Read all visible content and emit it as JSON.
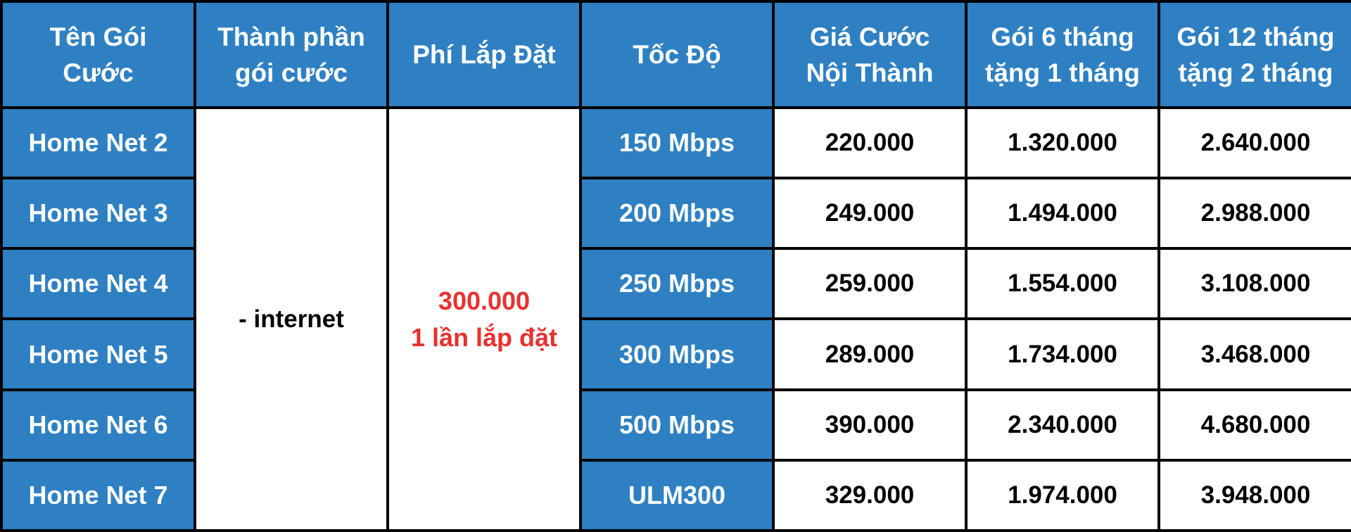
{
  "colors": {
    "header_bg": "#2e80c2",
    "header_text": "#ffffff",
    "cell_bg": "#ffffff",
    "grid_lines": "#000000",
    "install_fee_text": "#e8312f"
  },
  "headers": [
    {
      "line1": "Tên Gói",
      "line2": "Cước"
    },
    {
      "line1": "Thành phần",
      "line2": "gói cước"
    },
    {
      "line1": "Phí Lắp Đặt",
      "line2": ""
    },
    {
      "line1": "Tốc Độ",
      "line2": ""
    },
    {
      "line1": "Giá Cước",
      "line2": "Nội Thành"
    },
    {
      "line1": "Gói 6 tháng",
      "line2": "tặng 1 tháng"
    },
    {
      "line1": "Gói 12 tháng",
      "line2": "tặng 2 tháng"
    }
  ],
  "components": "- internet",
  "install_fee": {
    "amount": "300.000",
    "note": "1 lần lắp đặt"
  },
  "rows": [
    {
      "name": "Home Net 2",
      "speed": "150 Mbps",
      "price": "220.000",
      "six_months": "1.320.000",
      "twelve_months": "2.640.000"
    },
    {
      "name": "Home Net 3",
      "speed": "200 Mbps",
      "price": "249.000",
      "six_months": "1.494.000",
      "twelve_months": "2.988.000"
    },
    {
      "name": "Home Net 4",
      "speed": "250 Mbps",
      "price": "259.000",
      "six_months": "1.554.000",
      "twelve_months": "3.108.000"
    },
    {
      "name": "Home Net 5",
      "speed": "300 Mbps",
      "price": "289.000",
      "six_months": "1.734.000",
      "twelve_months": "3.468.000"
    },
    {
      "name": "Home Net 6",
      "speed": "500 Mbps",
      "price": "390.000",
      "six_months": "2.340.000",
      "twelve_months": "4.680.000"
    },
    {
      "name": "Home Net 7",
      "speed": "ULM300",
      "price": "329.000",
      "six_months": "1.974.000",
      "twelve_months": "3.948.000"
    }
  ]
}
